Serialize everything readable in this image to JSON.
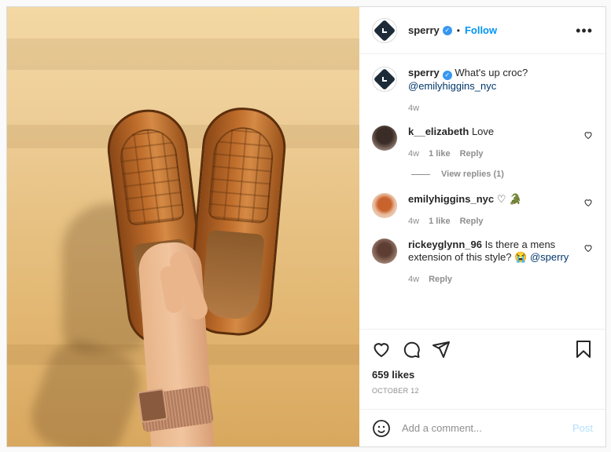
{
  "post": {
    "account": "sperry",
    "follow_label": "Follow",
    "dot": "•",
    "more_label": "•••"
  },
  "caption": {
    "name": "sperry",
    "text": "What's up croc?",
    "mention": "@emilyhiggins_nyc",
    "age": "4w"
  },
  "comments": [
    {
      "name": "k__elizabeth",
      "text": "Love",
      "age": "4w",
      "likes": "1 like",
      "reply": "Reply"
    },
    {
      "name": "emilyhiggins_nyc",
      "text": "♡ 🐊",
      "age": "4w",
      "likes": "1 like",
      "reply": "Reply"
    },
    {
      "name": "rickeyglynn_96",
      "text": "Is there a mens extension of this style? 😭",
      "mention": "@sperry",
      "age": "4w",
      "reply": "Reply"
    }
  ],
  "view_replies": "View replies (1)",
  "likes_text": "659 likes",
  "date_text": "OCTOBER 12",
  "add_comment": {
    "placeholder": "Add a comment...",
    "post_label": "Post"
  },
  "colors": {
    "follow": "#0095f6",
    "verified": "#3897f0",
    "mention": "#00376b",
    "post_disabled": "#b2dffc"
  },
  "icons": [
    "verified-badge-icon",
    "more-options-icon",
    "heart-icon",
    "comment-icon",
    "share-icon",
    "bookmark-icon",
    "emoji-icon"
  ]
}
